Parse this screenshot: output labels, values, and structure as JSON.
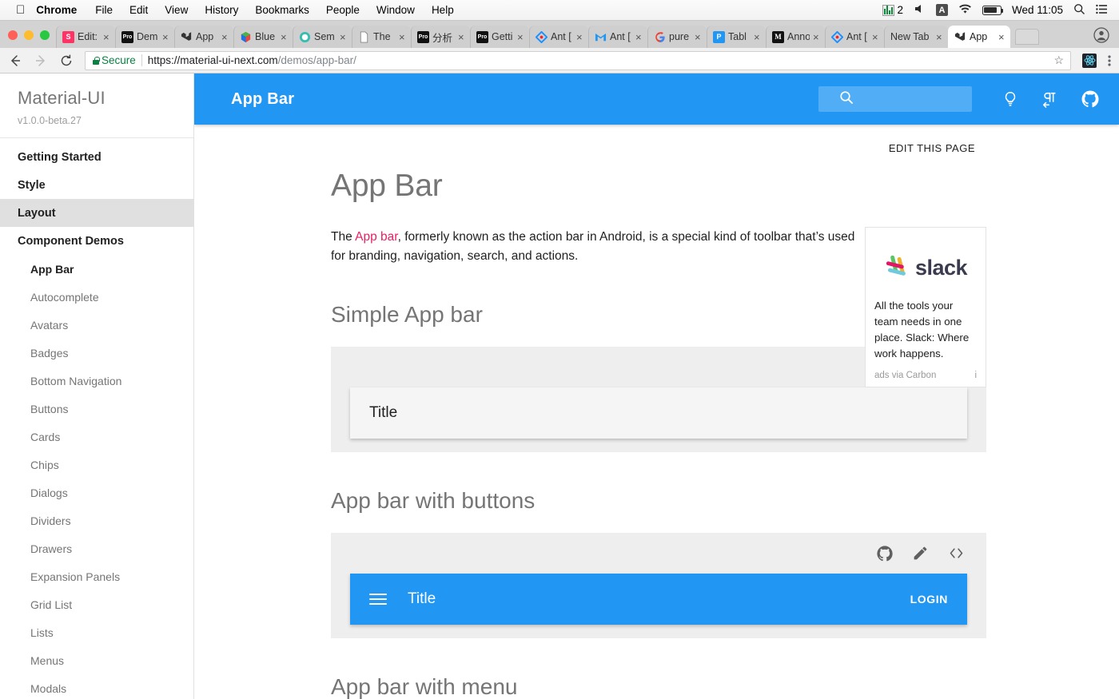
{
  "os_menubar": {
    "apple_icon": "apple-icon",
    "items": [
      "Chrome",
      "File",
      "Edit",
      "View",
      "History",
      "Bookmarks",
      "People",
      "Window",
      "Help"
    ],
    "status": {
      "equalizer_count": "2",
      "volume_icon": "volume-icon",
      "input_source": "A",
      "wifi_icon": "wifi-icon",
      "battery_icon": "battery-icon",
      "clock": "Wed 11:05",
      "search_icon": "spotlight-search-icon",
      "list_icon": "notification-center-icon"
    }
  },
  "browser": {
    "tabs": [
      {
        "label": "Edit:",
        "favicon": "S",
        "favicon_bg": "#ff3366",
        "active": false
      },
      {
        "label": "Dem",
        "favicon": "Pro",
        "favicon_bg": "#111111",
        "active": false
      },
      {
        "label": "App",
        "favicon": "mui",
        "favicon_bg": "transparent",
        "active": false
      },
      {
        "label": "Blue",
        "favicon": "cube",
        "favicon_bg": "transparent",
        "active": false
      },
      {
        "label": "Sem",
        "favicon": "sem",
        "favicon_bg": "transparent",
        "active": false
      },
      {
        "label": "The",
        "favicon": "doc",
        "favicon_bg": "transparent",
        "active": false
      },
      {
        "label": "分析",
        "favicon": "Pro",
        "favicon_bg": "#111111",
        "active": false
      },
      {
        "label": "Getti",
        "favicon": "Pro",
        "favicon_bg": "#111111",
        "active": false
      },
      {
        "label": "Ant [",
        "favicon": "ant",
        "favicon_bg": "transparent",
        "active": false
      },
      {
        "label": "Ant [",
        "favicon": "M",
        "favicon_bg": "transparent",
        "active": false
      },
      {
        "label": "pure",
        "favicon": "G",
        "favicon_bg": "transparent",
        "active": false
      },
      {
        "label": "Tabl",
        "favicon": "P",
        "favicon_bg": "#2196f3",
        "active": false
      },
      {
        "label": "Anno",
        "favicon": "M",
        "favicon_bg": "#111111",
        "active": false
      },
      {
        "label": "Ant [",
        "favicon": "ant",
        "favicon_bg": "transparent",
        "active": false
      },
      {
        "label": "New Tab",
        "favicon": "none",
        "favicon_bg": "transparent",
        "active": false
      },
      {
        "label": "App",
        "favicon": "mui",
        "favicon_bg": "transparent",
        "active": true
      }
    ],
    "close_glyph": "×",
    "toolbar": {
      "back_icon": "back-arrow-icon",
      "forward_icon": "forward-arrow-icon",
      "reload_icon": "reload-icon",
      "security_label": "Secure",
      "url_domain": "https://material-ui-next.com",
      "url_path": "/demos/app-bar/",
      "star_glyph": "☆",
      "extension_icon": "react-devtools-icon",
      "menu_icon": "chrome-menu-icon"
    }
  },
  "sidebar": {
    "title": "Material-UI",
    "version": "v1.0.0-beta.27",
    "items": [
      {
        "label": "Getting Started",
        "type": "section",
        "active": false
      },
      {
        "label": "Style",
        "type": "section",
        "active": false
      },
      {
        "label": "Layout",
        "type": "section",
        "active": true
      },
      {
        "label": "Component Demos",
        "type": "section",
        "active": false
      },
      {
        "label": "App Bar",
        "type": "sub",
        "active": true
      },
      {
        "label": "Autocomplete",
        "type": "sub",
        "active": false
      },
      {
        "label": "Avatars",
        "type": "sub",
        "active": false
      },
      {
        "label": "Badges",
        "type": "sub",
        "active": false
      },
      {
        "label": "Bottom Navigation",
        "type": "sub",
        "active": false
      },
      {
        "label": "Buttons",
        "type": "sub",
        "active": false
      },
      {
        "label": "Cards",
        "type": "sub",
        "active": false
      },
      {
        "label": "Chips",
        "type": "sub",
        "active": false
      },
      {
        "label": "Dialogs",
        "type": "sub",
        "active": false
      },
      {
        "label": "Dividers",
        "type": "sub",
        "active": false
      },
      {
        "label": "Drawers",
        "type": "sub",
        "active": false
      },
      {
        "label": "Expansion Panels",
        "type": "sub",
        "active": false
      },
      {
        "label": "Grid List",
        "type": "sub",
        "active": false
      },
      {
        "label": "Lists",
        "type": "sub",
        "active": false
      },
      {
        "label": "Menus",
        "type": "sub",
        "active": false
      },
      {
        "label": "Modals",
        "type": "sub",
        "active": false
      }
    ]
  },
  "appbar": {
    "title": "App Bar",
    "search_placeholder": "",
    "search_icon": "search-icon",
    "icons": [
      "lightbulb-icon",
      "text-direction-icon",
      "github-icon"
    ],
    "background": "#2196f3"
  },
  "main": {
    "edit_link": "EDIT THIS PAGE",
    "page_title": "App Bar",
    "intro_prefix": "The ",
    "intro_link": "App bar",
    "intro_rest": ", formerly known as the action bar in Android, is a special kind of toolbar that’s used for branding, navigation, search, and actions.",
    "link_color": "#e91e63",
    "sections": [
      {
        "heading": "Simple App bar",
        "actions": [
          "github-icon",
          "edit-pencil-icon",
          "code-icon"
        ],
        "demo": {
          "style": "light",
          "title": "Title",
          "menu": false,
          "action_label": ""
        }
      },
      {
        "heading": "App bar with buttons",
        "actions": [
          "github-icon",
          "edit-pencil-icon",
          "code-icon"
        ],
        "demo": {
          "style": "blue",
          "title": "Title",
          "menu": true,
          "action_label": "LOGIN"
        }
      },
      {
        "heading": "App bar with menu",
        "actions": [],
        "demo": null
      }
    ]
  },
  "ad": {
    "brand": "slack",
    "text": "All the tools your team needs in one place. Slack: Where work happens.",
    "footer": "ads via Carbon",
    "info": "i"
  }
}
